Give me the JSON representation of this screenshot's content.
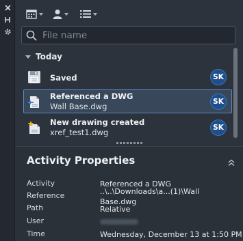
{
  "search": {
    "placeholder": "File name"
  },
  "group": {
    "label": "Today"
  },
  "items": [
    {
      "title": "Saved",
      "subtitle": "",
      "user": "SK",
      "icon": "save-disk-icon"
    },
    {
      "title": "Referenced a DWG",
      "subtitle": "Wall Base.dwg",
      "user": "SK",
      "icon": "referenced-file-icon"
    },
    {
      "title": "New drawing created",
      "subtitle": "xref_test1.dwg",
      "user": "SK",
      "icon": "new-drawing-icon"
    }
  ],
  "properties": {
    "title": "Activity Properties",
    "labels": {
      "activity": "Activity",
      "reference": "Reference",
      "path": "Path",
      "user": "User",
      "time": "Time"
    },
    "values": {
      "activity": "Referenced a DWG",
      "reference": "..\\..\\Downloads\\a...(1)\\Wall",
      "reference_2": "Base.dwg",
      "path": "Relative",
      "time": "Wednesday, December 13 at 1:50 PM"
    }
  },
  "colors": {
    "accent": "#5b8ac2",
    "avatar": "#1f4f8a",
    "panel": "#2d333c"
  }
}
